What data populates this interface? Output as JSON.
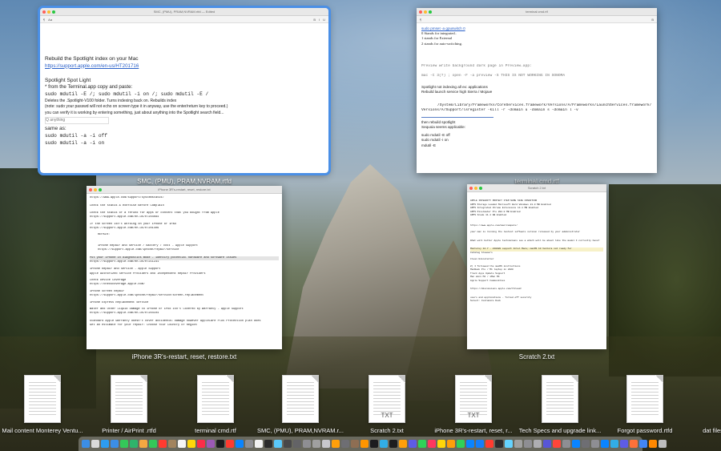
{
  "windows": [
    {
      "id": "w1",
      "title": "SMC, (PMU), PRAM,NVRAM.rtfd — Edited",
      "caption": "SMC, (PMU), PRAM,NVRAM.rtfd",
      "lines": [
        {
          "text": "Rebuild the Spotlight index on your Mac",
          "style": "big"
        },
        {
          "text": "https://support.apple.com/en-us/HT201716",
          "style": "link"
        },
        {
          "text": "",
          "style": ""
        },
        {
          "text": "Spotlight Spot Light",
          "style": "big"
        },
        {
          "text": " * from the Terminal.app copy and paste:",
          "style": ""
        },
        {
          "text": "sudo mdutil -E /; sudo mdutil -i on /; sudo mdutil -E /",
          "style": "mono"
        },
        {
          "text": "Deletes the .Spotlight-V100 folder. Turns indexing back on. Rebuilds index",
          "style": ""
        },
        {
          "text": "(note: sudo your passwd will not echo on screen type it in anyway, use the enter/return key to proceed.)",
          "style": ""
        },
        {
          "text": "you can verify it is working by entering something, just about anything into the Spotlight search field...",
          "style": ""
        },
        {
          "text": "Q anything",
          "style": "gray"
        },
        {
          "text": "same as:",
          "style": "big"
        },
        {
          "text": "sudo mdutil -a -i off",
          "style": "mono"
        },
        {
          "text": "sudo mdutil -a -i on",
          "style": "mono"
        }
      ]
    },
    {
      "id": "w2",
      "title": "terminal cmd.rtf",
      "caption": "terminal cmd.rtf",
      "lines": [
        {
          "text": "sudo pmset -a gpuswitch 0",
          "style": "link"
        },
        {
          "text": "0 Stands for integrated..",
          "style": ""
        },
        {
          "text": "1 stands for External",
          "style": ""
        },
        {
          "text": "2 stands for auto-switching.",
          "style": ""
        },
        {
          "text": "Preview write background dark page in Preview.app:",
          "style": "mono"
        },
        {
          "text": "mac -C 3(?) ; open -F -a preview -S THIS IS NOT WORKING IN SONOMA",
          "style": "mono"
        },
        {
          "text": "Spotlight not indexing all ex: applications",
          "style": ""
        },
        {
          "text": "Rebuild launch service  high Sierra / Mojave",
          "style": ""
        },
        {
          "text": "/System/Library/Frameworks/CoreServices.framework/Versions/A/Frameworks/LaunchServices.framework/",
          "style": "mono"
        },
        {
          "text": "Versions/A/Support/lsregister -kill -r -domain u -domain s -domain l -v",
          "style": "mono"
        },
        {
          "text": "then rebuild spotlight",
          "style": ""
        },
        {
          "text": "Sequoia seems applicable:",
          "style": ""
        },
        {
          "text": "sudo mdutil -E off",
          "style": ""
        },
        {
          "text": "sudo mdutil -i on",
          "style": ""
        },
        {
          "text": "mdutil -E",
          "style": ""
        }
      ]
    },
    {
      "id": "w3",
      "title": "iPhone 3R's-restart, reset, restore.txt",
      "caption": "iPhone 3R's-restart, reset, restore.txt",
      "lines": [
        {
          "text": "https://www.apple.com/support/systemstatus/",
          "style": "mono"
        },
        {
          "text": "Check the status & exercise Before Complain",
          "style": "mono"
        },
        {
          "text": "Check the status of a refund for apps or content that you bought from Apple",
          "style": "mono"
        },
        {
          "text": "https://support.apple.com/en-us/HT204084",
          "style": "mono"
        },
        {
          "text": "If the screen isn't working on your iPhone or iPad",
          "style": "mono"
        },
        {
          "text": "https://support.apple.com/en-us/HT201406",
          "style": "mono"
        },
        {
          "text": "REPAIR:",
          "style": "mono"
        },
        {
          "text": "iPhone Repair and Service / Battery / cost - Apple Support",
          "style": "mono"
        },
        {
          "text": "https://support.apple.com/iphone/repair/service",
          "style": "mono"
        },
        {
          "text": "Put your iPhone in diagnostics mode - identify potential hardware and software issues",
          "style": "mono hl"
        },
        {
          "text": "https://support.apple.com/en-us/HT211231",
          "style": "mono"
        },
        {
          "text": "iPhone Repair and Service - Apple Support",
          "style": "mono"
        },
        {
          "text": "Apple Authorized Service Providers and Independent Repair Providers",
          "style": "mono"
        },
        {
          "text": "Check Device Coverage",
          "style": "mono"
        },
        {
          "text": "https://checkcoverage.apple.com/",
          "style": "mono"
        },
        {
          "text": "iPhone Screen Repair",
          "style": "mono"
        },
        {
          "text": "https://support.apple.com/iphone/repair/service/screen-replacement",
          "style": "mono"
        },
        {
          "text": "iPhone Express Replacement Service",
          "style": "mono"
        },
        {
          "text": "Water and Other Liquid Damage to iPhone or iPod isn't Covered by Warranty - Apple Support",
          "style": "mono"
        },
        {
          "text": "https://support.apple.com/en-us/HT204104",
          "style": "mono"
        },
        {
          "text": "Standard Apple warranty doesn't cover accidental damage however AppleCare Plus Protection plan does",
          "style": "mono"
        },
        {
          "text": "Get an estimate for your repair: Choose Your Country or Region",
          "style": "mono"
        }
      ]
    },
    {
      "id": "w4",
      "title": "Scratch 2.txt",
      "caption": "Scratch 2.txt",
      "lines": [
        {
          "text": "APPLE INTEGRITY PROTECT   ITEM NAME    SIZE   CONDITION",
          "style": "mono"
        },
        {
          "text": "  APPS Storage Loaded   Microsoft Word Windows  21.0 MB  Enabled",
          "style": "mono"
        },
        {
          "text": "  APPS Integrated Chrome Extensions   14.1 MB  Enabled",
          "style": "mono"
        },
        {
          "text": "  APPS Pixelmator Pro   202.0 MB  Enabled",
          "style": "mono"
        },
        {
          "text": "  APPS Xcode  11.1 GB  Enabled",
          "style": "mono"
        },
        {
          "text": "https://www.apple.com/mac/compare/",
          "style": "mono"
        },
        {
          "text": "your mac is running the lastest software version released by your administrator",
          "style": "mono"
        },
        {
          "text": "What will better Apple technicians see a which will be about like the model I currently have?",
          "style": "mono"
        },
        {
          "text": "Monterey 12.7 - 21G920 support Intel Macs; macOS 13 Ventura not ready for",
          "style": "mono hl"
        },
        {
          "text": "Catalog browsers",
          "style": "mono"
        },
        {
          "text": "Clean Uninstaller",
          "style": "mono"
        },
        {
          "text": "Z) I followed the macOS instructions",
          "style": "mono"
        },
        {
          "text": "MacBook Pro / M1 laptop in 2020",
          "style": "mono"
        },
        {
          "text": "Track Apps Update Support",
          "style": "mono"
        },
        {
          "text": "Mac mini M4 / iMac M4",
          "style": "mono"
        },
        {
          "text": "Apple Support Communities",
          "style": "mono"
        },
        {
          "text": "https://discussions.apple.com/thread/",
          "style": "mono"
        },
        {
          "text": "users and applications - Turned off security",
          "style": "mono"
        },
        {
          "text": "Select: Customize Dock",
          "style": "mono"
        }
      ]
    }
  ],
  "files": [
    {
      "label": "Mail content Monterey Ventu...",
      "ext": ""
    },
    {
      "label": "Printer / AirPrint .rtfd",
      "ext": ""
    },
    {
      "label": "terminal cmd.rtf",
      "ext": ""
    },
    {
      "label": "SMC, (PMU), PRAM,NVRAM.r...",
      "ext": ""
    },
    {
      "label": "Scratch 2.txt",
      "ext": "TXT"
    },
    {
      "label": "iPhone 3R's-restart, reset, r...",
      "ext": "TXT"
    },
    {
      "label": "Tech Specs and upgrade link...",
      "ext": ""
    },
    {
      "label": "Forgot password.rtfd",
      "ext": ""
    },
    {
      "label": "dat files",
      "ext": ""
    }
  ],
  "dock": {
    "icons": [
      "finder",
      "launchpad",
      "safari",
      "mail",
      "messages",
      "maps",
      "photos",
      "facetime",
      "calendar",
      "contacts",
      "reminders",
      "notes",
      "music",
      "podcasts",
      "tv",
      "news",
      "appstore",
      "settings",
      "textedit",
      "terminal",
      "preview",
      "activity",
      "console",
      "diskutil",
      "keychain",
      "screenshot",
      "calculator",
      "dictionary",
      "chess",
      "books",
      "stocks",
      "weather",
      "clock",
      "home",
      "shortcuts",
      "findmy",
      "voicememos",
      "freeform",
      "pages",
      "numbers",
      "keynote",
      "xcode",
      "photobooth",
      "quicktime",
      "ia",
      "fontbook",
      "automator",
      "scripteditor",
      "colorsync",
      "grapher",
      "systeminfo",
      "migration",
      "bootcamp",
      "audiomidi",
      "bluetooth",
      "airport",
      "vpn",
      "firefox",
      "chrome",
      "vlc",
      "trash"
    ],
    "colors": [
      "#3c8ee6",
      "#d9d9d9",
      "#2d9cf0",
      "#3c8ee6",
      "#34c759",
      "#2fb36b",
      "#f4a742",
      "#34c759",
      "#ff3b30",
      "#a2845e",
      "#f5f5f5",
      "#ffd60a",
      "#fa2d48",
      "#9b59b6",
      "#1c1c1e",
      "#ff3b30",
      "#0a84ff",
      "#8e8e93",
      "#f2f2f2",
      "#2b2b2b",
      "#5ac8fa",
      "#48484a",
      "#636366",
      "#8e8e93",
      "#a0a0a0",
      "#c7c7cc",
      "#ff9f0a",
      "#6e6e73",
      "#8e6e53",
      "#ff9500",
      "#1c1c1e",
      "#32ade6",
      "#1c1c1e",
      "#ff9f0a",
      "#5e5ce6",
      "#30d158",
      "#ff375f",
      "#ffd60a",
      "#ff9f0a",
      "#30d158",
      "#0a84ff",
      "#147efb",
      "#ff3b30",
      "#2c2c2e",
      "#64d2ff",
      "#a0a0a0",
      "#8e8e93",
      "#aeaeb2",
      "#5856d6",
      "#ff453a",
      "#8e8e93",
      "#0a84ff",
      "#6e6e73",
      "#8e8e93",
      "#0a84ff",
      "#32ade6",
      "#5e5ce6",
      "#ff7139",
      "#4285f4",
      "#ff8800",
      "#bdbdbd"
    ]
  }
}
